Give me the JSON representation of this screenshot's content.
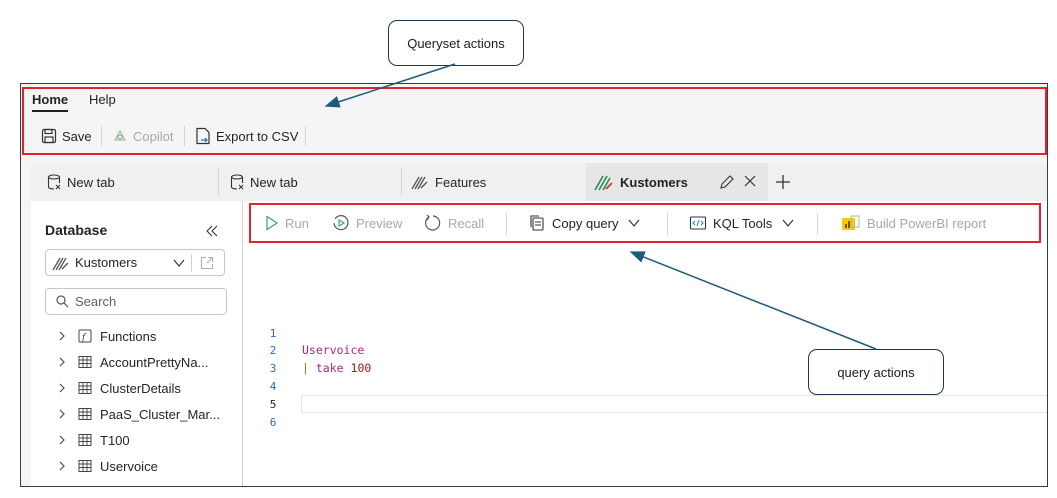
{
  "annotations": {
    "queryset_actions": "Queryset actions",
    "query_actions": "query actions",
    "highlight_color": "#e0242b",
    "arrow_color": "#1f5a78"
  },
  "menu": {
    "tabs": [
      {
        "label": "Home",
        "active": true
      },
      {
        "label": "Help",
        "active": false
      }
    ]
  },
  "ribbon": {
    "save": "Save",
    "copilot": "Copilot",
    "export": "Export to CSV"
  },
  "query_tabs": [
    {
      "label": "New tab",
      "icon": "database-icon"
    },
    {
      "label": "New tab",
      "icon": "database-icon"
    },
    {
      "label": "Features",
      "icon": "kusto-icon"
    },
    {
      "label": "Kustomers",
      "icon": "kusto-icon",
      "active": true
    }
  ],
  "sidebar": {
    "title": "Database",
    "database": "Kustomers",
    "search_placeholder": "Search",
    "items": [
      {
        "label": "Functions",
        "icon": "function-icon"
      },
      {
        "label": "AccountPrettyNa...",
        "icon": "table-icon"
      },
      {
        "label": "ClusterDetails",
        "icon": "table-icon"
      },
      {
        "label": "PaaS_Cluster_Mar...",
        "icon": "table-icon"
      },
      {
        "label": "T100",
        "icon": "table-icon"
      },
      {
        "label": "Uservoice",
        "icon": "table-icon"
      }
    ]
  },
  "query_toolbar": {
    "run": "Run",
    "preview": "Preview",
    "recall": "Recall",
    "copy_query": "Copy query",
    "kql_tools": "KQL Tools",
    "powerbi": "Build PowerBI report"
  },
  "editor": {
    "line_numbers": [
      "1",
      "2",
      "3",
      "4",
      "5",
      "6"
    ],
    "line2": "Uservoice",
    "line3_pipe": "|",
    "line3_op": "take",
    "line3_num": "100"
  }
}
